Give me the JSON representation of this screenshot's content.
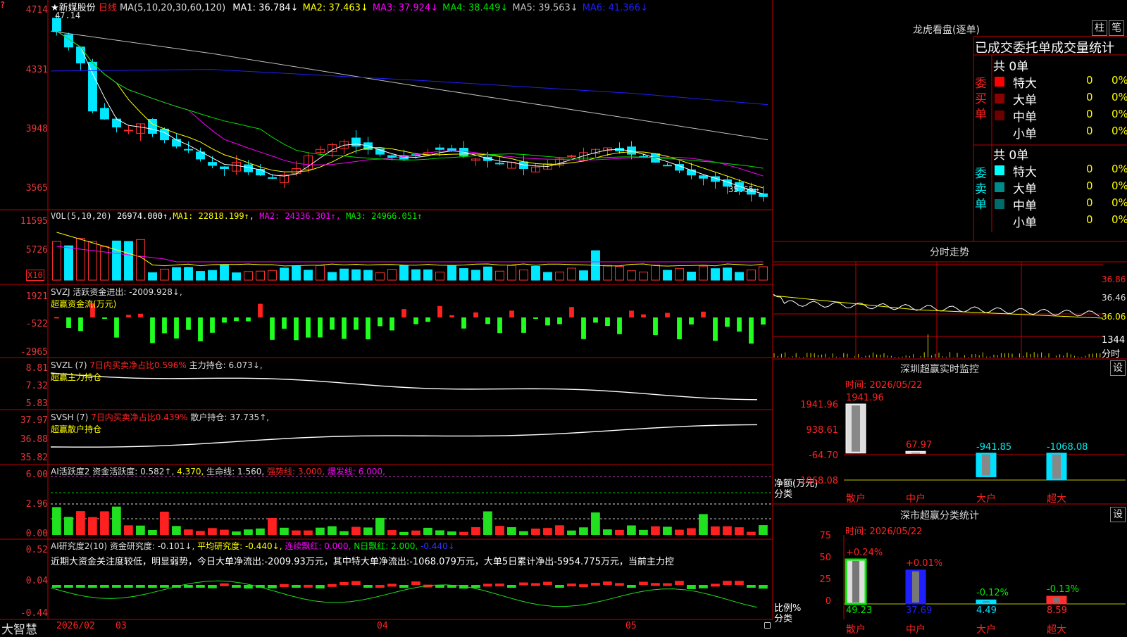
{
  "stock": {
    "star": "★",
    "name": "新媒股份",
    "period": "日线",
    "ma_spec": "MA(5,10,20,30,60,120)",
    "high_label": "47.14",
    "last_label": "35.65→",
    "ma": [
      {
        "label": "MA1: 36.784↓",
        "color": "#ffffff"
      },
      {
        "label": "MA2: 37.463↓",
        "color": "#ffff00"
      },
      {
        "label": "MA3: 37.924↓",
        "color": "#ff00ff"
      },
      {
        "label": "MA4: 38.449↓",
        "color": "#00e000"
      },
      {
        "label": "MA5: 39.563↓",
        "color": "#c0c0c0"
      },
      {
        "label": "MA6: 41.366↓",
        "color": "#2020ff"
      }
    ],
    "yticks": [
      "4714",
      "4331",
      "3948",
      "3565"
    ]
  },
  "vol": {
    "label": "VOL(5,10,20)",
    "value": "26974.000↑,",
    "ma1": "MA1: 22818.199↑,",
    "ma2": "MA2: 24336.301↑,",
    "ma3": "MA3: 24966.051↑",
    "yticks": [
      "11595",
      "5726"
    ],
    "unit": "X10"
  },
  "svzj": {
    "label": "SVZJ",
    "title": "活跃资金进出: -2009.928↓,",
    "sub": "超赢资金流(万元)",
    "yticks": [
      "1921",
      "-522",
      "-2965"
    ]
  },
  "svzl": {
    "label": "SVZL (7)",
    "ratio": "7日内买卖净占比0.596%",
    "hold": "主力持仓: 6.073↓,",
    "sub": "超赢主力持仓",
    "yticks": [
      "8.81",
      "7.32",
      "5.83"
    ]
  },
  "svsh": {
    "label": "SVSH (7)",
    "ratio": "7日内买卖净占比0.439%",
    "hold": "散户持仓: 37.735↑,",
    "sub": "超赢散户持仓",
    "yticks": [
      "37.97",
      "36.88",
      "35.82"
    ]
  },
  "ai1": {
    "label": "AI活跃度2",
    "a": "资金活跃度: 0.582↑,",
    "b": "4.370,",
    "c": "生命线: 1.560,",
    "d": "强势线: 3.000,",
    "e": "爆发线: 6.000,",
    "yticks": [
      "6.00",
      "2.96",
      "0.00"
    ]
  },
  "ai2": {
    "label": "AI研究度2(10)",
    "a": "资金研究度: -0.101↓,",
    "b": "平均研究度: -0.440↓,",
    "c": "连续飘红: 0.000,",
    "d": "N日飘红: 2.000,",
    "e": "-0.440↓",
    "desc": "近期大资金关注度较低，明显弱势，今日大单净流出:-2009.93万元，其中特大单净流出:-1068.079万元，大单5日累计净出-5954.775万元，当前主力控",
    "yticks": [
      "0.52",
      "0.04",
      "-0.44"
    ]
  },
  "footer": {
    "brand": "大智慧",
    "d1": "2026/02",
    "d2": "03",
    "d3": "04",
    "d4": "05"
  },
  "right": {
    "dragon": {
      "title": "龙虎看盘(逐单)",
      "btn1": "柱",
      "btn2": "笔",
      "head": "已成交委托单成交量统计",
      "buy_total": "共 0单",
      "buy_label": "委买单",
      "sell_total": "共 0单",
      "sell_label": "委卖单",
      "buy_rows": [
        {
          "name": "特大",
          "v": "0",
          "p": "0%",
          "c": "#ff0000"
        },
        {
          "name": "大单",
          "v": "0",
          "p": "0%",
          "c": "#8b0000"
        },
        {
          "name": "中单",
          "v": "0",
          "p": "0%",
          "c": "#6a0000"
        },
        {
          "name": "小单",
          "v": "0",
          "p": "0%",
          "c": ""
        }
      ],
      "sell_rows": [
        {
          "name": "特大",
          "v": "0",
          "p": "0%",
          "c": "#00ffff"
        },
        {
          "name": "大单",
          "v": "0",
          "p": "0%",
          "c": "#008b8b"
        },
        {
          "name": "中单",
          "v": "0",
          "p": "0%",
          "c": "#006b6b"
        },
        {
          "name": "小单",
          "v": "0",
          "p": "0%",
          "c": ""
        }
      ]
    },
    "intraday": {
      "title": "分时走势",
      "p1": "36.86",
      "p2": "36.46",
      "p3": "36.06",
      "vol": "1344",
      "vlabel": "分时"
    },
    "monitor": {
      "title": "深圳超赢实时监控",
      "btn": "设",
      "time": "时间: 2026/05/22",
      "ylabel": "净额(万元)",
      "xlabel": "分类",
      "yticks": [
        "1941.96",
        "938.61",
        "-64.70",
        "-1068.08"
      ],
      "bars": [
        {
          "cat": "散户",
          "v": "1941.96"
        },
        {
          "cat": "中户",
          "v": "67.97"
        },
        {
          "cat": "大户",
          "v": "-941.85"
        },
        {
          "cat": "超大",
          "v": "-1068.08"
        }
      ]
    },
    "cls": {
      "title": "深市超赢分类统计",
      "btn": "设",
      "time": "时间: 2026/05/22",
      "ylabel": "比例%",
      "xlabel": "分类",
      "yticks": [
        "75",
        "50",
        "25",
        "0"
      ],
      "bars": [
        {
          "cat": "散户",
          "v": "49.23",
          "chg": "+0.24%"
        },
        {
          "cat": "中户",
          "v": "37.69",
          "chg": "+0.01%"
        },
        {
          "cat": "大户",
          "v": "4.49",
          "chg": "-0.12%"
        },
        {
          "cat": "超大",
          "v": "8.59",
          "chg": "-0.13%"
        }
      ]
    }
  }
}
